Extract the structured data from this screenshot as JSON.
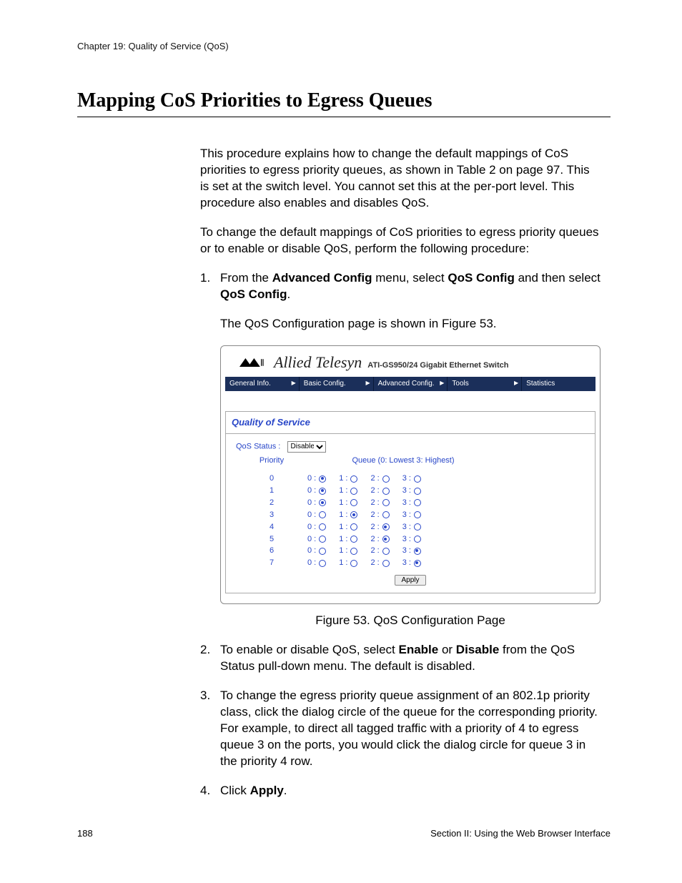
{
  "chapter_header": "Chapter 19: Quality of Service (QoS)",
  "section_title": "Mapping CoS Priorities to Egress Queues",
  "intro_para": "This procedure explains how to change the default mappings of CoS priorities to egress priority queues, as shown in Table 2 on page 97. This is set at the switch level. You cannot set this at the per-port level. This procedure also enables and disables QoS.",
  "lead_para": "To change the default mappings of CoS priorities to egress priority queues or to enable or disable QoS, perform the following procedure:",
  "steps": {
    "s1_pre": "From the ",
    "s1_b1": "Advanced Config",
    "s1_mid1": " menu, select ",
    "s1_b2": "QoS Config",
    "s1_mid2": " and then select ",
    "s1_b3": "QoS Config",
    "s1_end": ".",
    "s1_after": "The QoS Configuration page is shown in Figure 53.",
    "s2_pre": "To enable or disable QoS, select ",
    "s2_b1": "Enable",
    "s2_mid": " or ",
    "s2_b2": "Disable",
    "s2_post": " from the QoS Status pull-down menu. The default is disabled.",
    "s3": "To change the egress priority queue assignment of an 802.1p priority class, click the dialog circle of the queue for the corresponding priority. For example, to direct all tagged traffic with a priority of 4 to egress queue 3 on the ports, you would click the dialog circle for queue 3 in the priority 4 row.",
    "s4_pre": "Click ",
    "s4_b": "Apply",
    "s4_post": "."
  },
  "fig": {
    "brand": "Allied Telesyn",
    "subbrand": "ATI-GS950/24 Gigabit Ethernet Switch",
    "nav": [
      "General Info.",
      "Basic Config.",
      "Advanced Config.",
      "Tools",
      "Statistics"
    ],
    "panel_title": "Quality of Service",
    "status_label": "QoS Status :",
    "status_value": "Disable",
    "col_priority": "Priority",
    "col_queue": "Queue  (0: Lowest 3: Highest)",
    "apply": "Apply",
    "queue_labels": [
      "0 :",
      "1 :",
      "2 :",
      "3 :"
    ],
    "rows": [
      {
        "priority": "0",
        "selected": 0
      },
      {
        "priority": "1",
        "selected": 0
      },
      {
        "priority": "2",
        "selected": 0
      },
      {
        "priority": "3",
        "selected": 1
      },
      {
        "priority": "4",
        "selected": 2
      },
      {
        "priority": "5",
        "selected": 2
      },
      {
        "priority": "6",
        "selected": 3
      },
      {
        "priority": "7",
        "selected": 3
      }
    ]
  },
  "caption": "Figure 53. QoS Configuration Page",
  "footer": {
    "page": "188",
    "section": "Section II: Using the Web Browser Interface"
  }
}
